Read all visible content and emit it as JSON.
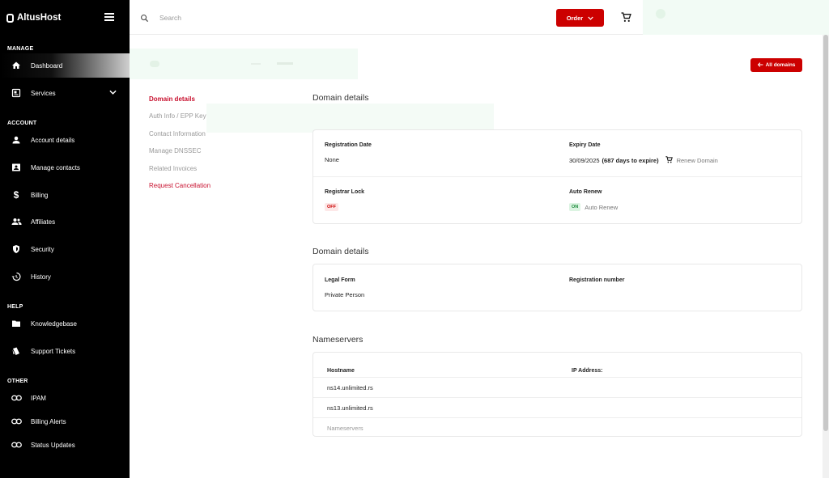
{
  "app": {
    "brand": "AltusHost"
  },
  "sidebar": {
    "sections": {
      "manage": "MANAGE",
      "account": "ACCOUNT",
      "help": "HELP",
      "other": "OTHER"
    },
    "items": [
      {
        "label": "Dashboard",
        "icon": "home-icon"
      },
      {
        "label": "Services",
        "icon": "services-icon"
      },
      {
        "label": "Account details",
        "icon": "person-icon"
      },
      {
        "label": "Manage contacts",
        "icon": "contacts-icon"
      },
      {
        "label": "Billing",
        "icon": "dollar-icon"
      },
      {
        "label": "Affiliates",
        "icon": "people-icon"
      },
      {
        "label": "Security",
        "icon": "shield-icon"
      },
      {
        "label": "History",
        "icon": "history-icon"
      },
      {
        "label": "Knowledgebase",
        "icon": "folder-icon"
      },
      {
        "label": "Support Tickets",
        "icon": "tickets-icon"
      },
      {
        "label": "IPAM",
        "icon": "link-icon"
      },
      {
        "label": "Billing Alerts",
        "icon": "link-icon"
      },
      {
        "label": "Status Updates",
        "icon": "link-icon"
      }
    ]
  },
  "topbar": {
    "search_placeholder": "Search",
    "order_label": "Order"
  },
  "content": {
    "all_domains_label": "All domains",
    "side_nav": [
      "Domain details",
      "Auth Info / EPP Key",
      "Contact Information",
      "Manage DNSSEC",
      "Related Invoices",
      "Request Cancellation"
    ],
    "section1": {
      "title": "Domain details",
      "registration_date_label": "Registration Date",
      "registration_date_value": "None",
      "expiry_date_label": "Expiry Date",
      "expiry_date_value": "30/09/2025",
      "expiry_days": "(687 days to expire)",
      "renew_label": "Renew Domain",
      "registrar_lock_label": "Registrar Lock",
      "registrar_lock_value": "OFF",
      "auto_renew_label": "Auto Renew",
      "auto_renew_badge": "ON",
      "auto_renew_text": "Auto Renew"
    },
    "section2": {
      "title": "Domain details",
      "legal_form_label": "Legal Form",
      "legal_form_value": "Private Person",
      "registration_number_label": "Registration number"
    },
    "nameservers": {
      "title": "Nameservers",
      "col_hostname": "Hostname",
      "col_ip": "IP Address:",
      "rows": [
        "ns14.unlimited.rs",
        "ns13.unlimited.rs"
      ],
      "placeholder": "Nameservers"
    }
  },
  "colors": {
    "accent": "#cc0000",
    "sidebar_bg": "#000000",
    "link_red": "#c8102e"
  }
}
